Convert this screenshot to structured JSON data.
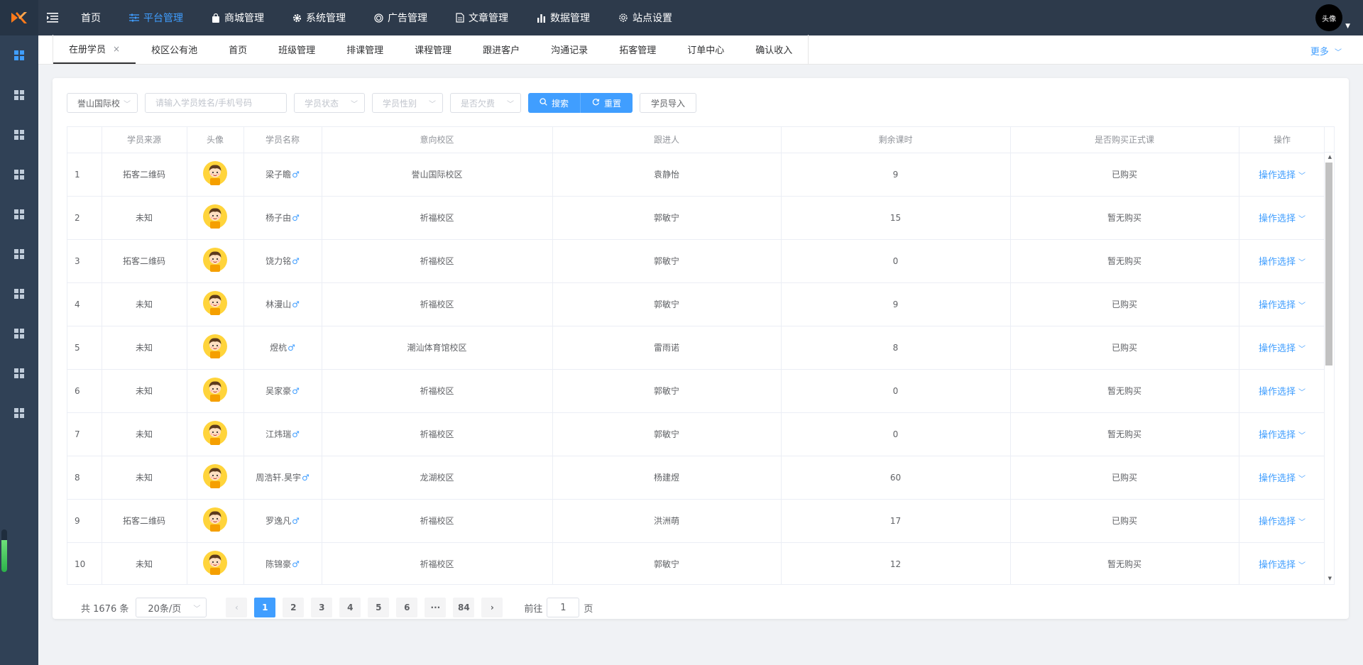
{
  "colors": {
    "primary": "#409eff",
    "topbar": "#2d3a4b",
    "sidebar": "#304156"
  },
  "topnav": {
    "items": [
      {
        "label": "首页",
        "icon": ""
      },
      {
        "label": "平台管理",
        "icon": "sliders-icon",
        "active": true
      },
      {
        "label": "商城管理",
        "icon": "shopping-bag-icon"
      },
      {
        "label": "系统管理",
        "icon": "gear-icon"
      },
      {
        "label": "广告管理",
        "icon": "target-icon"
      },
      {
        "label": "文章管理",
        "icon": "document-icon"
      },
      {
        "label": "数据管理",
        "icon": "bar-chart-icon"
      },
      {
        "label": "站点设置",
        "icon": "gear-outline-icon"
      }
    ],
    "avatar_label": "头像"
  },
  "tabs": {
    "items": [
      "在册学员",
      "校区公有池",
      "首页",
      "班级管理",
      "排课管理",
      "课程管理",
      "跟进客户",
      "沟通记录",
      "拓客管理",
      "订单中心",
      "确认收入"
    ],
    "more_label": "更多"
  },
  "filters": {
    "campus": "誉山国际校",
    "search_placeholder": "请输入学员姓名/手机号码",
    "status_placeholder": "学员状态",
    "gender_placeholder": "学员性别",
    "debt_placeholder": "是否欠费",
    "search_label": "搜索",
    "reset_label": "重置",
    "import_label": "学员导入"
  },
  "table": {
    "headers": [
      "",
      "学员来源",
      "头像",
      "学员名称",
      "意向校区",
      "跟进人",
      "剩余课时",
      "是否购买正式课",
      "操作"
    ],
    "male_symbol": "♂",
    "op_label": "操作选择",
    "rows": [
      {
        "idx": "1",
        "source": "拓客二维码",
        "name": "梁子瞻",
        "campus": "誉山国际校区",
        "follower": "袁静怡",
        "hours": "9",
        "bought": "已购买"
      },
      {
        "idx": "2",
        "source": "未知",
        "name": "杨子由",
        "campus": "祈福校区",
        "follower": "郭敏宁",
        "hours": "15",
        "bought": "暂无购买"
      },
      {
        "idx": "3",
        "source": "拓客二维码",
        "name": "饶力铭",
        "campus": "祈福校区",
        "follower": "郭敏宁",
        "hours": "0",
        "bought": "暂无购买"
      },
      {
        "idx": "4",
        "source": "未知",
        "name": "林漫山",
        "campus": "祈福校区",
        "follower": "郭敏宁",
        "hours": "9",
        "bought": "已购买"
      },
      {
        "idx": "5",
        "source": "未知",
        "name": "煜杭",
        "campus": "潮汕体育馆校区",
        "follower": "雷雨诺",
        "hours": "8",
        "bought": "已购买"
      },
      {
        "idx": "6",
        "source": "未知",
        "name": "吴家豪",
        "campus": "祈福校区",
        "follower": "郭敏宁",
        "hours": "0",
        "bought": "暂无购买"
      },
      {
        "idx": "7",
        "source": "未知",
        "name": "江炜瑞",
        "campus": "祈福校区",
        "follower": "郭敏宁",
        "hours": "0",
        "bought": "暂无购买"
      },
      {
        "idx": "8",
        "source": "未知",
        "name": "周浩轩.昊宇",
        "campus": "龙湖校区",
        "follower": "杨建煜",
        "hours": "60",
        "bought": "已购买"
      },
      {
        "idx": "9",
        "source": "拓客二维码",
        "name": "罗逸凡",
        "campus": "祈福校区",
        "follower": "洪洲萌",
        "hours": "17",
        "bought": "已购买"
      },
      {
        "idx": "10",
        "source": "未知",
        "name": "陈锦豪",
        "campus": "祈福校区",
        "follower": "郭敏宁",
        "hours": "12",
        "bought": "暂无购买"
      }
    ]
  },
  "pagination": {
    "total_text": "共 1676 条",
    "page_size": "20条/页",
    "pages": [
      "1",
      "2",
      "3",
      "4",
      "5",
      "6",
      "···",
      "84"
    ],
    "current": "1",
    "goto_prefix": "前往",
    "goto_value": "1",
    "goto_suffix": "页"
  },
  "sidebar_gauge_fraction": 0.75
}
